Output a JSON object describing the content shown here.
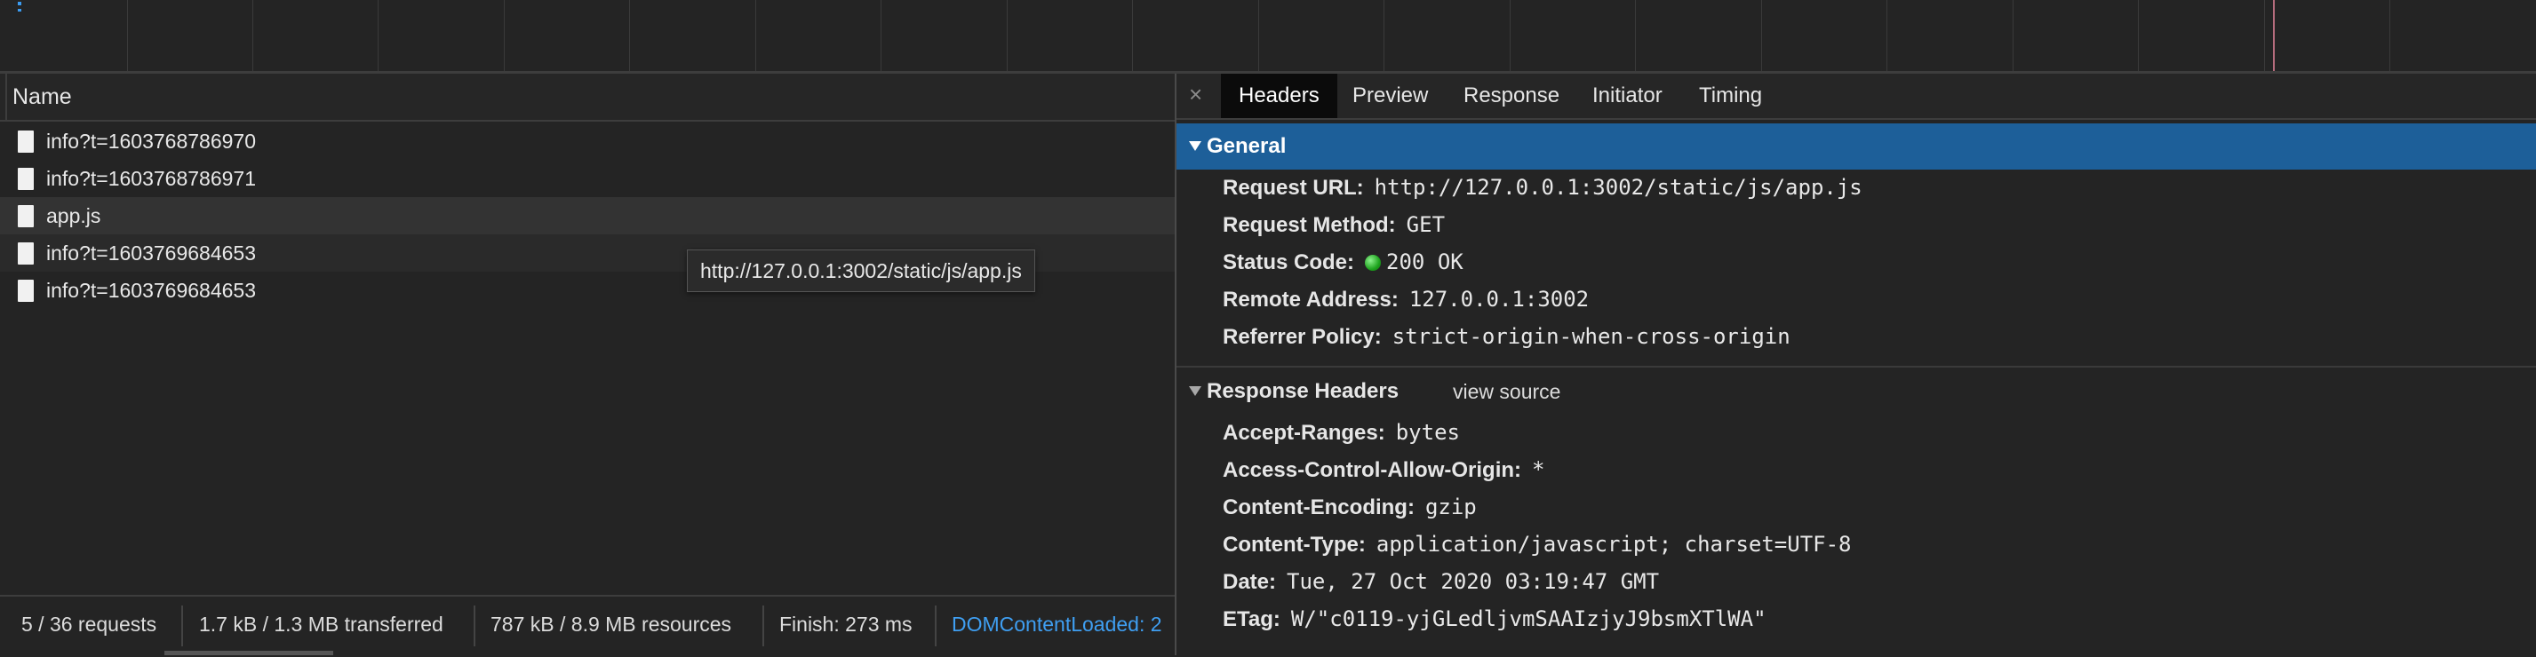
{
  "list": {
    "column_name": "Name",
    "rows": [
      {
        "name": "info?t=1603768786970"
      },
      {
        "name": "info?t=1603768786971"
      },
      {
        "name": "app.js"
      },
      {
        "name": "info?t=1603769684653"
      },
      {
        "name": "info?t=1603769684653"
      }
    ],
    "tooltip": "http://127.0.0.1:3002/static/js/app.js"
  },
  "status": {
    "requests": "5 / 36 requests",
    "transferred": "1.7 kB / 1.3 MB transferred",
    "resources": "787 kB / 8.9 MB resources",
    "finish": "Finish: 273 ms",
    "dcl": "DOMContentLoaded: 2"
  },
  "tabs": {
    "close": "×",
    "headers": "Headers",
    "preview": "Preview",
    "response": "Response",
    "initiator": "Initiator",
    "timing": "Timing"
  },
  "general": {
    "title": "General",
    "request_url_k": "Request URL:",
    "request_url_v": "http://127.0.0.1:3002/static/js/app.js",
    "method_k": "Request Method:",
    "method_v": "GET",
    "status_k": "Status Code:",
    "status_v": "200 OK",
    "remote_k": "Remote Address:",
    "remote_v": "127.0.0.1:3002",
    "referrer_k": "Referrer Policy:",
    "referrer_v": "strict-origin-when-cross-origin"
  },
  "response_headers": {
    "title": "Response Headers",
    "view_source": "view source",
    "items": [
      {
        "k": "Accept-Ranges:",
        "v": "bytes"
      },
      {
        "k": "Access-Control-Allow-Origin:",
        "v": "*"
      },
      {
        "k": "Content-Encoding:",
        "v": "gzip"
      },
      {
        "k": "Content-Type:",
        "v": "application/javascript; charset=UTF-8"
      },
      {
        "k": "Date:",
        "v": "Tue, 27 Oct 2020 03:19:47 GMT"
      },
      {
        "k": "ETag:",
        "v": "W/\"c0119-yjGLedljvmSAAIzjyJ9bsmXTlWA\""
      }
    ]
  },
  "colors": {
    "accent": "#1d5f99",
    "link_blue": "#3f9ff2",
    "status_ok": "#1ea31e"
  }
}
